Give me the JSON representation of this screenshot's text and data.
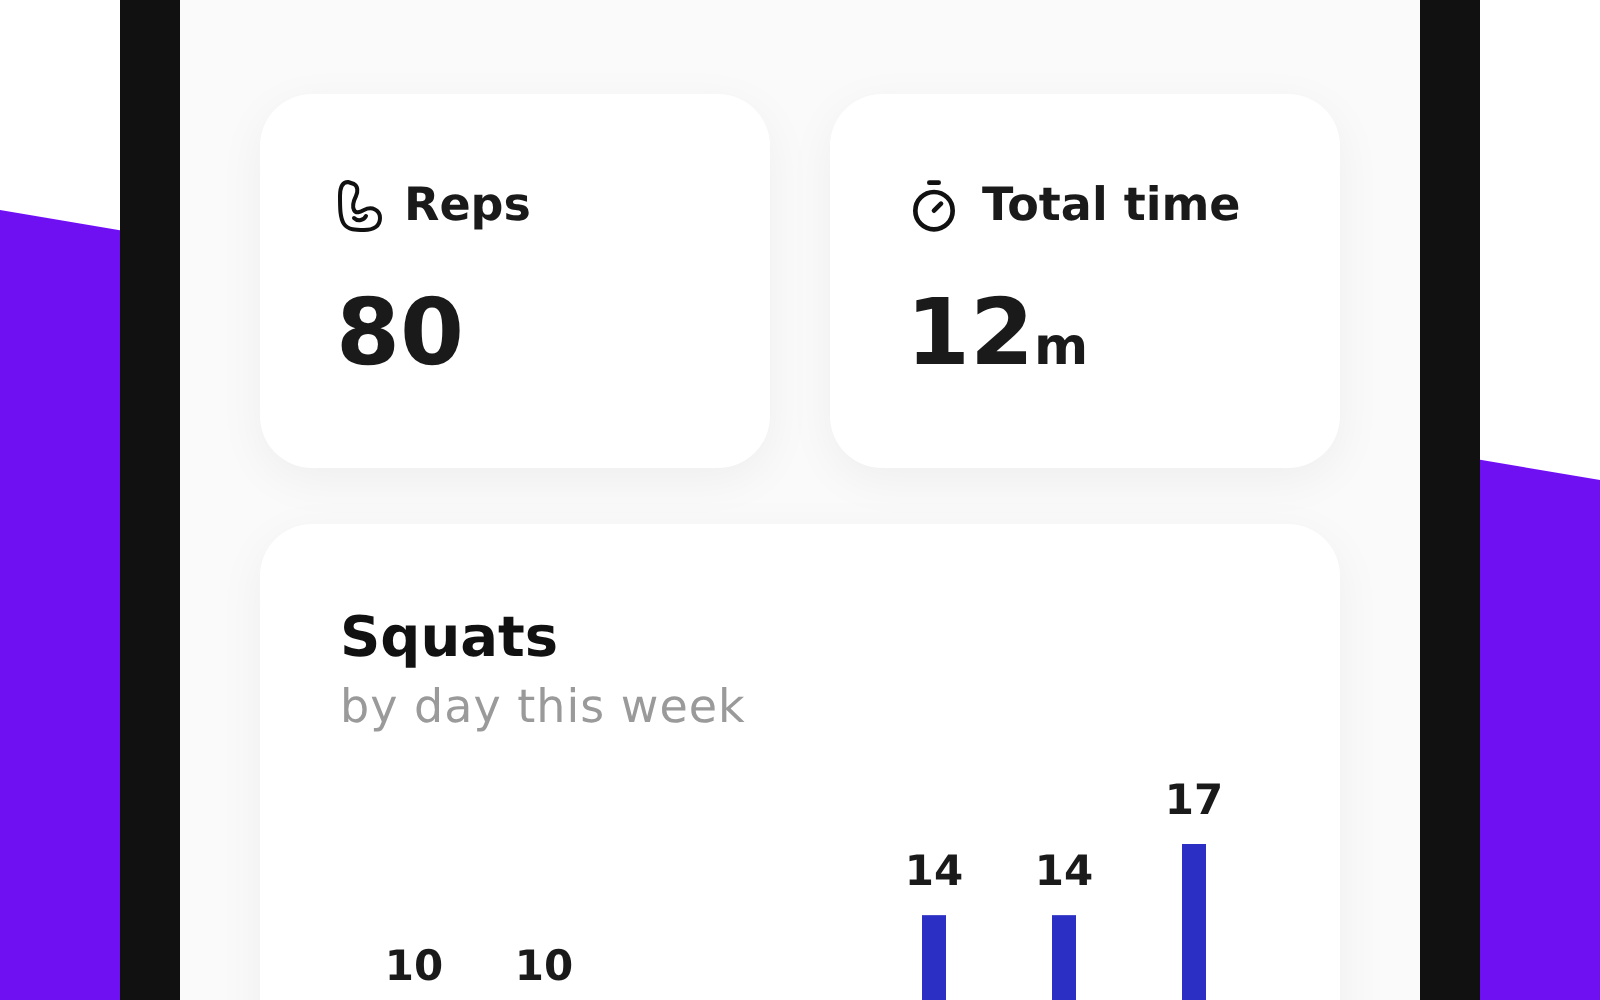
{
  "stats": [
    {
      "kind": "reps",
      "label": "Reps",
      "value": "80"
    },
    {
      "kind": "time",
      "label": "Total time",
      "value": "12",
      "unit": "m"
    }
  ],
  "chart_card": {
    "title": "Squats",
    "subtitle": "by day this week",
    "bars": [
      {
        "kind": "labeled",
        "value": "10"
      },
      {
        "kind": "labeled",
        "value": "10"
      },
      {
        "kind": "below"
      },
      {
        "kind": "below"
      },
      {
        "kind": "labeled",
        "value": "14"
      },
      {
        "kind": "labeled",
        "value": "14"
      },
      {
        "kind": "labeled",
        "value": "17"
      }
    ]
  }
}
